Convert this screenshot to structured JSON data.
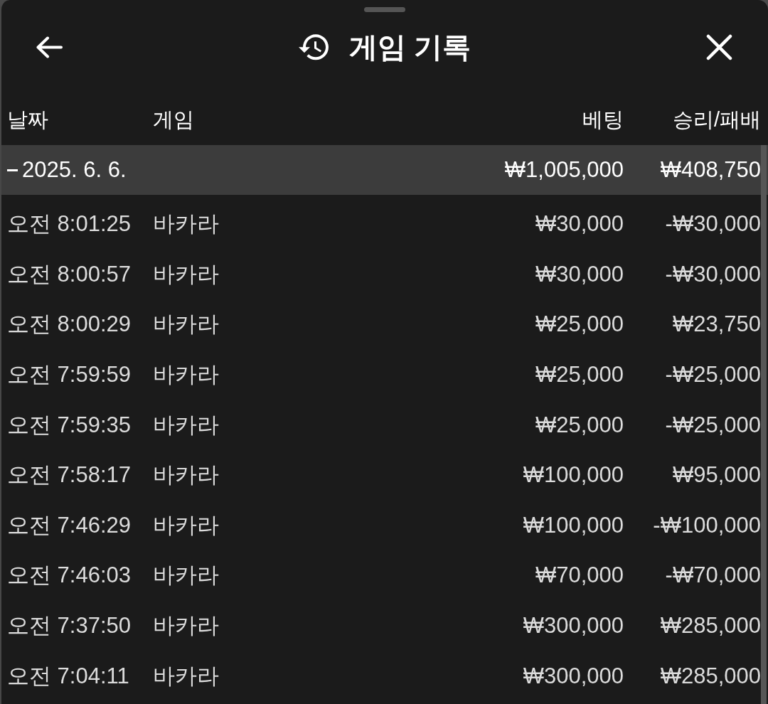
{
  "sheet": {
    "title": "게임 기록"
  },
  "table": {
    "columns": [
      "날짜",
      "게임",
      "베팅",
      "승리/패배"
    ],
    "groups": [
      {
        "date": "2025. 6. 6.",
        "expanded": true,
        "bet": "₩1,005,000",
        "result": "₩408,750",
        "rows": [
          {
            "time": "오전 8:01:25",
            "game": "바카라",
            "bet": "₩30,000",
            "result": "-₩30,000"
          },
          {
            "time": "오전 8:00:57",
            "game": "바카라",
            "bet": "₩30,000",
            "result": "-₩30,000"
          },
          {
            "time": "오전 8:00:29",
            "game": "바카라",
            "bet": "₩25,000",
            "result": "₩23,750"
          },
          {
            "time": "오전 7:59:59",
            "game": "바카라",
            "bet": "₩25,000",
            "result": "-₩25,000"
          },
          {
            "time": "오전 7:59:35",
            "game": "바카라",
            "bet": "₩25,000",
            "result": "-₩25,000"
          },
          {
            "time": "오전 7:58:17",
            "game": "바카라",
            "bet": "₩100,000",
            "result": "₩95,000"
          },
          {
            "time": "오전 7:46:29",
            "game": "바카라",
            "bet": "₩100,000",
            "result": "-₩100,000"
          },
          {
            "time": "오전 7:46:03",
            "game": "바카라",
            "bet": "₩70,000",
            "result": "-₩70,000"
          },
          {
            "time": "오전 7:37:50",
            "game": "바카라",
            "bet": "₩300,000",
            "result": "₩285,000"
          },
          {
            "time": "오전 7:04:11",
            "game": "바카라",
            "bet": "₩300,000",
            "result": "₩285,000"
          }
        ]
      }
    ]
  }
}
